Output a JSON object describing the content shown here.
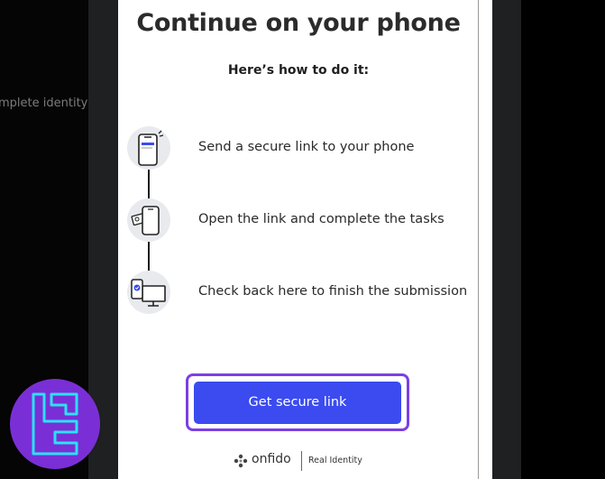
{
  "background": {
    "partial_text": "mplete identity"
  },
  "card": {
    "title": "Continue on your phone",
    "subtitle": "Here’s how to do it:",
    "steps": [
      {
        "text": "Send a secure link to your phone",
        "icon": "phone-link-icon"
      },
      {
        "text": "Open the link and complete the tasks",
        "icon": "phone-tasks-icon"
      },
      {
        "text": "Check back here to finish the submission",
        "icon": "phone-desktop-icon"
      }
    ],
    "cta_label": "Get secure link"
  },
  "footer": {
    "brand": "onfido",
    "tagline": "Real Identity"
  },
  "colors": {
    "accent": "#3b4bf0",
    "focus_outline": "#7b3fe4",
    "watermark": "#7a2fd6",
    "watermark_glyph": "#2ce0f6"
  }
}
